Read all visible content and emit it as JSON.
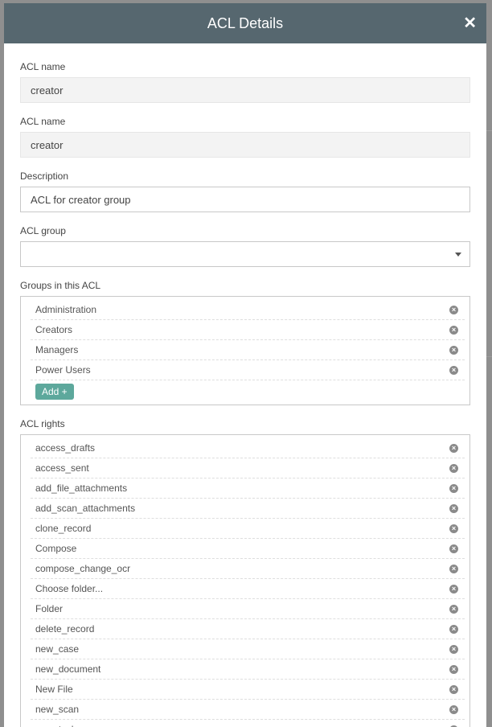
{
  "dialog": {
    "title": "ACL Details",
    "close_symbol": "✕"
  },
  "fields": {
    "acl_name_1": {
      "label": "ACL name",
      "value": "creator"
    },
    "acl_name_2": {
      "label": "ACL name",
      "value": "creator"
    },
    "description": {
      "label": "Description",
      "value": "ACL for creator group"
    },
    "acl_group": {
      "label": "ACL group",
      "value": ""
    }
  },
  "groups": {
    "label": "Groups in this ACL",
    "items": [
      "Administration",
      "Creators",
      "Managers",
      "Power Users"
    ],
    "add_label": "Add +"
  },
  "rights": {
    "label": "ACL rights",
    "items": [
      "access_drafts",
      "access_sent",
      "add_file_attachments",
      "add_scan_attachments",
      "clone_record",
      "Compose",
      "compose_change_ocr",
      "Choose folder...",
      "Folder",
      "delete_record",
      "new_case",
      "new_document",
      "New File",
      "new_scan",
      "new_task"
    ]
  },
  "icons": {
    "remove": "remove-circle-icon",
    "close": "close-icon",
    "dropdown": "caret-down-icon"
  },
  "colors": {
    "header": "#56676f",
    "add_button": "#5da89c",
    "overlay": "#8f8f8f"
  }
}
